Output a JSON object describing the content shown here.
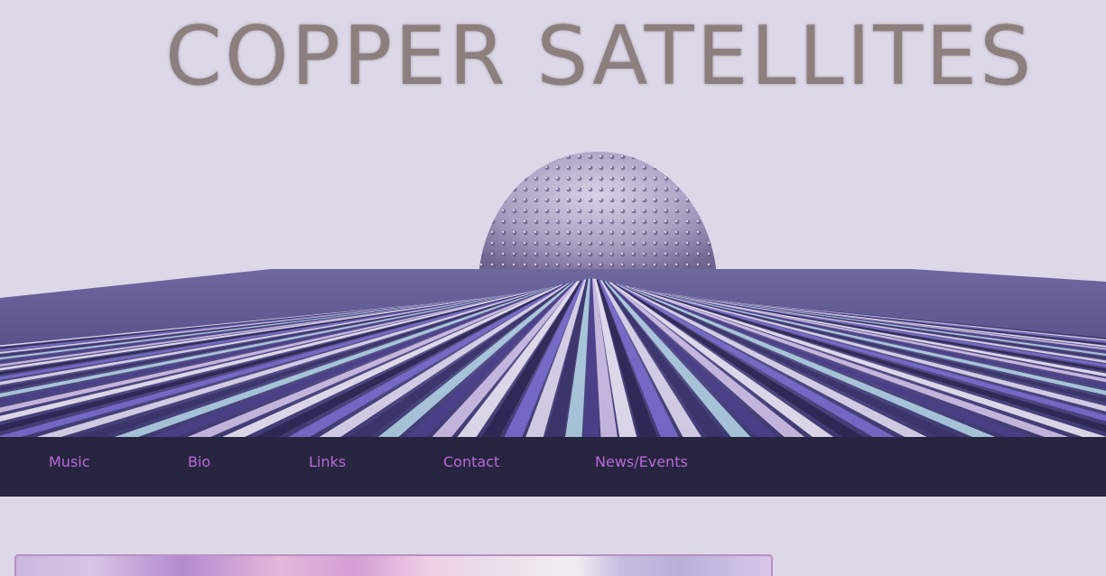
{
  "site": {
    "title": "COPPER SATELLITES"
  },
  "nav": {
    "items": [
      {
        "label": "Music"
      },
      {
        "label": "Bio"
      },
      {
        "label": "Links"
      },
      {
        "label": "Contact"
      },
      {
        "label": "News/Events"
      }
    ]
  },
  "colors": {
    "background": "#dcd8e8",
    "nav_background": "#272440",
    "nav_link": "#b76ad8",
    "title": "#8c807f",
    "frame_border": "#b98fc0"
  }
}
